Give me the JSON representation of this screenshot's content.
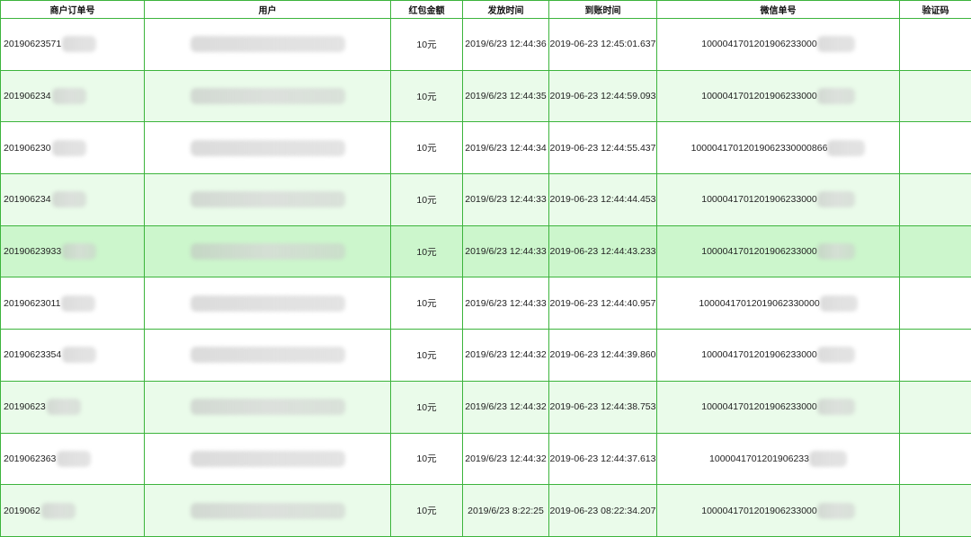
{
  "headers": {
    "order_no": "商户订单号",
    "user": "用户",
    "amount": "红包金额",
    "send_time": "发放时间",
    "arrive_time": "到账时间",
    "wechat_no": "微信单号",
    "verify_code": "验证码"
  },
  "rows": [
    {
      "order_no": "20190623571",
      "amount": "10元",
      "send_time": "2019/6/23 12:44:36",
      "arrive_time": "2019-06-23 12:45:01.637",
      "wechat_no": "1000041701201906233000"
    },
    {
      "order_no": "201906234",
      "amount": "10元",
      "send_time": "2019/6/23 12:44:35",
      "arrive_time": "2019-06-23 12:44:59.093",
      "wechat_no": "1000041701201906233000"
    },
    {
      "order_no": "201906230",
      "amount": "10元",
      "send_time": "2019/6/23 12:44:34",
      "arrive_time": "2019-06-23 12:44:55.437",
      "wechat_no": "10000417012019062330000866"
    },
    {
      "order_no": "201906234",
      "amount": "10元",
      "send_time": "2019/6/23 12:44:33",
      "arrive_time": "2019-06-23 12:44:44.453",
      "wechat_no": "1000041701201906233000"
    },
    {
      "order_no": "20190623933",
      "amount": "10元",
      "send_time": "2019/6/23 12:44:33",
      "arrive_time": "2019-06-23 12:44:43.233",
      "wechat_no": "1000041701201906233000"
    },
    {
      "order_no": "20190623011",
      "amount": "10元",
      "send_time": "2019/6/23 12:44:33",
      "arrive_time": "2019-06-23 12:44:40.957",
      "wechat_no": "10000417012019062330000"
    },
    {
      "order_no": "20190623354",
      "amount": "10元",
      "send_time": "2019/6/23 12:44:32",
      "arrive_time": "2019-06-23 12:44:39.860",
      "wechat_no": "1000041701201906233000"
    },
    {
      "order_no": "20190623",
      "amount": "10元",
      "send_time": "2019/6/23 12:44:32",
      "arrive_time": "2019-06-23 12:44:38.753",
      "wechat_no": "1000041701201906233000"
    },
    {
      "order_no": "2019062363",
      "amount": "10元",
      "send_time": "2019/6/23 12:44:32",
      "arrive_time": "2019-06-23 12:44:37.613",
      "wechat_no": "1000041701201906233"
    },
    {
      "order_no": "2019062",
      "amount": "10元",
      "send_time": "2019/6/23 8:22:25",
      "arrive_time": "2019-06-23 08:22:34.207",
      "wechat_no": "1000041701201906233000"
    }
  ],
  "colors": {
    "border": "#3cb43c",
    "row_green": "#eafbea",
    "row_highlight": "#ccf6cc"
  }
}
